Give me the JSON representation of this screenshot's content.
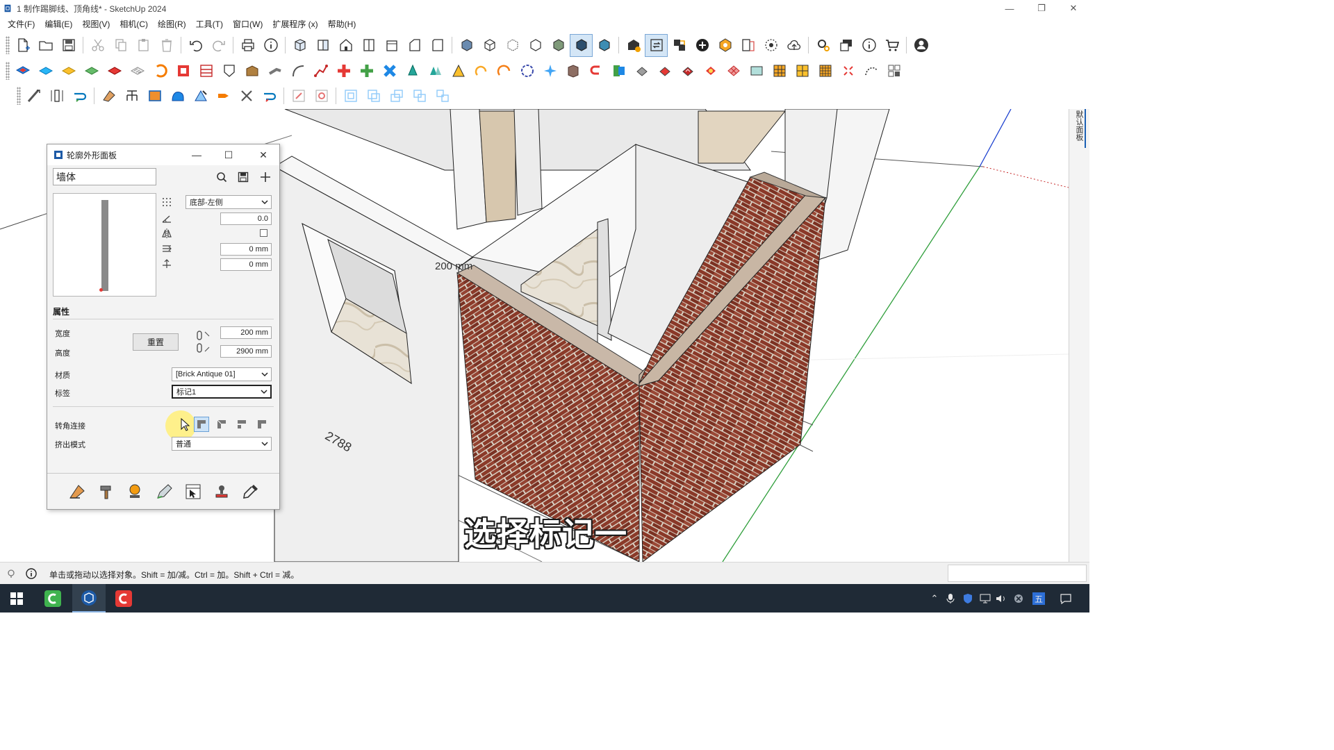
{
  "window": {
    "title": "1 制作踢脚线、顶角线* - SketchUp 2024",
    "minimize": "—",
    "maximize": "❐",
    "close": "✕"
  },
  "menu": [
    "文件(F)",
    "编辑(E)",
    "视图(V)",
    "相机(C)",
    "绘图(R)",
    "工具(T)",
    "窗口(W)",
    "扩展程序 (x)",
    "帮助(H)"
  ],
  "viewport": {
    "dimension_label": "200 mm",
    "floor_dim_label": "2788",
    "subtitle": "选择标记一"
  },
  "right_panel_tab": "默认面板",
  "profile_panel": {
    "title": "轮廓外形面板",
    "name_value": "墙体",
    "alignment_select": "底部-左侧",
    "angle_value": "0.0",
    "offset_x_value": "0 mm",
    "offset_y_value": "0 mm",
    "properties_heading": "属性",
    "width_label": "宽度",
    "height_label": "高度",
    "reset_button": "重置",
    "width_value": "200 mm",
    "height_value": "2900 mm",
    "material_label": "材质",
    "material_select": "[Brick Antique 01]",
    "tag_label": "标签",
    "tag_select": "标记1",
    "corner_label": "转角连接",
    "extrude_label": "挤出模式",
    "extrude_select": "普通"
  },
  "statusbar": {
    "hint": "单击或拖动以选择对象。Shift = 加/减。Ctrl = 加。Shift + Ctrl = 减。"
  },
  "taskbar": {
    "ime": "五"
  },
  "colors": {
    "accent": "#1a5fb4",
    "brick": "#8a3a2a",
    "taskbar": "#1f2a36",
    "wall": "#f2f2f2"
  }
}
